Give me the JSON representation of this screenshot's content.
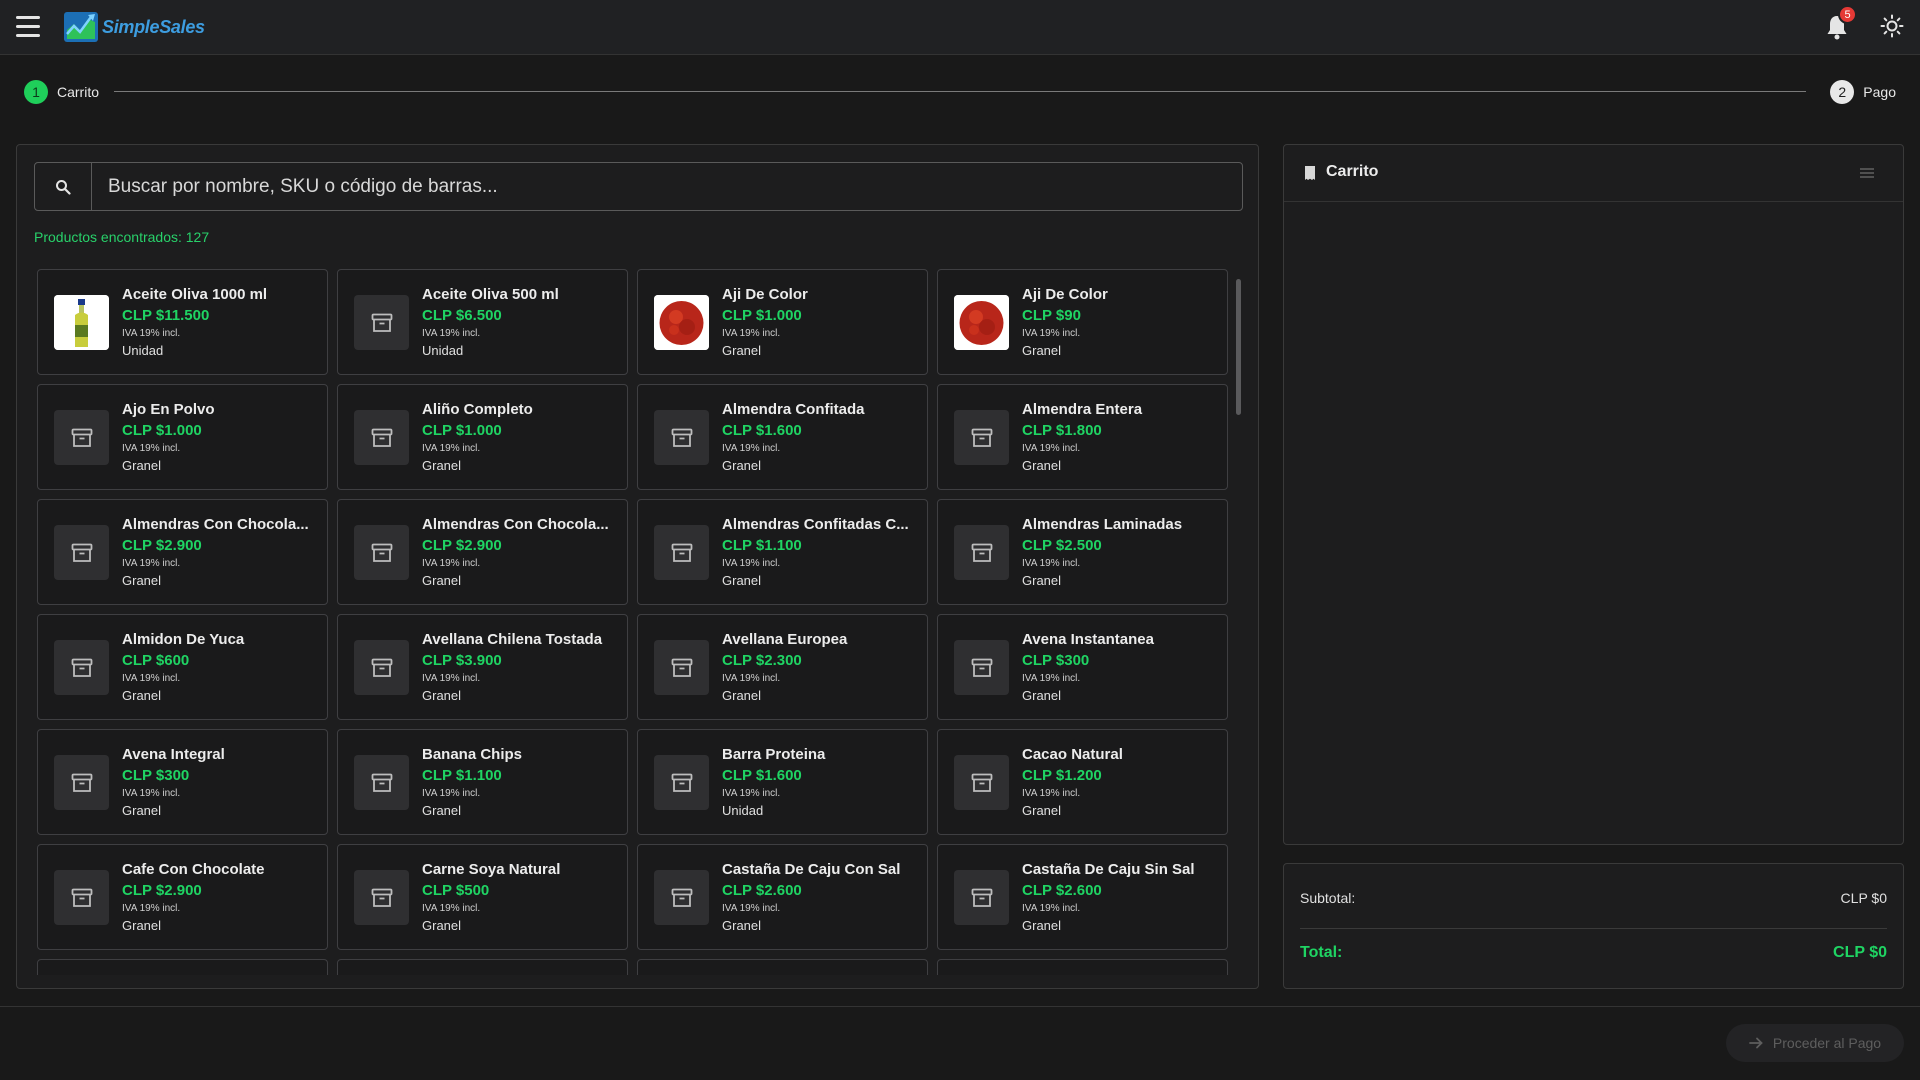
{
  "header": {
    "brand": "SimpleSales",
    "notifications_count": "5"
  },
  "stepper": {
    "steps": [
      {
        "number": "1",
        "label": "Carrito",
        "active": true
      },
      {
        "number": "2",
        "label": "Pago",
        "active": false
      }
    ]
  },
  "search": {
    "placeholder": "Buscar por nombre, SKU o código de barras...",
    "value": ""
  },
  "results": {
    "found_text": "Productos encontrados: 127"
  },
  "products": [
    {
      "name": "Aceite Oliva 1000 ml",
      "price": "CLP $11.500",
      "tax": "IVA 19% incl.",
      "unit": "Unidad",
      "image": "olive-oil-bottle"
    },
    {
      "name": "Aceite Oliva 500 ml",
      "price": "CLP $6.500",
      "tax": "IVA 19% incl.",
      "unit": "Unidad",
      "image": "placeholder-box"
    },
    {
      "name": "Aji De Color",
      "price": "CLP $1.000",
      "tax": "IVA 19% incl.",
      "unit": "Granel",
      "image": "paprika-powder"
    },
    {
      "name": "Aji De Color",
      "price": "CLP $90",
      "tax": "IVA 19% incl.",
      "unit": "Granel",
      "image": "paprika-powder"
    },
    {
      "name": "Ajo En Polvo",
      "price": "CLP $1.000",
      "tax": "IVA 19% incl.",
      "unit": "Granel",
      "image": "placeholder-box"
    },
    {
      "name": "Aliño Completo",
      "price": "CLP $1.000",
      "tax": "IVA 19% incl.",
      "unit": "Granel",
      "image": "placeholder-box"
    },
    {
      "name": "Almendra Confitada",
      "price": "CLP $1.600",
      "tax": "IVA 19% incl.",
      "unit": "Granel",
      "image": "placeholder-box"
    },
    {
      "name": "Almendra Entera",
      "price": "CLP $1.800",
      "tax": "IVA 19% incl.",
      "unit": "Granel",
      "image": "placeholder-box"
    },
    {
      "name": "Almendras Con Chocola...",
      "price": "CLP $2.900",
      "tax": "IVA 19% incl.",
      "unit": "Granel",
      "image": "placeholder-box"
    },
    {
      "name": "Almendras Con Chocola...",
      "price": "CLP $2.900",
      "tax": "IVA 19% incl.",
      "unit": "Granel",
      "image": "placeholder-box"
    },
    {
      "name": "Almendras Confitadas C...",
      "price": "CLP $1.100",
      "tax": "IVA 19% incl.",
      "unit": "Granel",
      "image": "placeholder-box"
    },
    {
      "name": "Almendras Laminadas",
      "price": "CLP $2.500",
      "tax": "IVA 19% incl.",
      "unit": "Granel",
      "image": "placeholder-box"
    },
    {
      "name": "Almidon De Yuca",
      "price": "CLP $600",
      "tax": "IVA 19% incl.",
      "unit": "Granel",
      "image": "placeholder-box"
    },
    {
      "name": "Avellana Chilena Tostada",
      "price": "CLP $3.900",
      "tax": "IVA 19% incl.",
      "unit": "Granel",
      "image": "placeholder-box"
    },
    {
      "name": "Avellana Europea",
      "price": "CLP $2.300",
      "tax": "IVA 19% incl.",
      "unit": "Granel",
      "image": "placeholder-box"
    },
    {
      "name": "Avena Instantanea",
      "price": "CLP $300",
      "tax": "IVA 19% incl.",
      "unit": "Granel",
      "image": "placeholder-box"
    },
    {
      "name": "Avena Integral",
      "price": "CLP $300",
      "tax": "IVA 19% incl.",
      "unit": "Granel",
      "image": "placeholder-box"
    },
    {
      "name": "Banana Chips",
      "price": "CLP $1.100",
      "tax": "IVA 19% incl.",
      "unit": "Granel",
      "image": "placeholder-box"
    },
    {
      "name": "Barra Proteina",
      "price": "CLP $1.600",
      "tax": "IVA 19% incl.",
      "unit": "Unidad",
      "image": "placeholder-box"
    },
    {
      "name": "Cacao Natural",
      "price": "CLP $1.200",
      "tax": "IVA 19% incl.",
      "unit": "Granel",
      "image": "placeholder-box"
    },
    {
      "name": "Cafe Con Chocolate",
      "price": "CLP $2.900",
      "tax": "IVA 19% incl.",
      "unit": "Granel",
      "image": "placeholder-box"
    },
    {
      "name": "Carne Soya Natural",
      "price": "CLP $500",
      "tax": "IVA 19% incl.",
      "unit": "Granel",
      "image": "placeholder-box"
    },
    {
      "name": "Castaña De Caju Con Sal",
      "price": "CLP $2.600",
      "tax": "IVA 19% incl.",
      "unit": "Granel",
      "image": "placeholder-box"
    },
    {
      "name": "Castaña De Caju Sin Sal",
      "price": "CLP $2.600",
      "tax": "IVA 19% incl.",
      "unit": "Granel",
      "image": "placeholder-box"
    }
  ],
  "cart": {
    "title": "Carrito",
    "subtotal_label": "Subtotal:",
    "subtotal_value": "CLP $0",
    "total_label": "Total:",
    "total_value": "CLP $0",
    "proceed_label": "Proceder al Pago"
  },
  "colors": {
    "accent_green": "#1fd463",
    "background": "#191919",
    "panel": "#1d1d1e",
    "brand_blue": "#3d9de0",
    "badge_red": "#e53935"
  }
}
